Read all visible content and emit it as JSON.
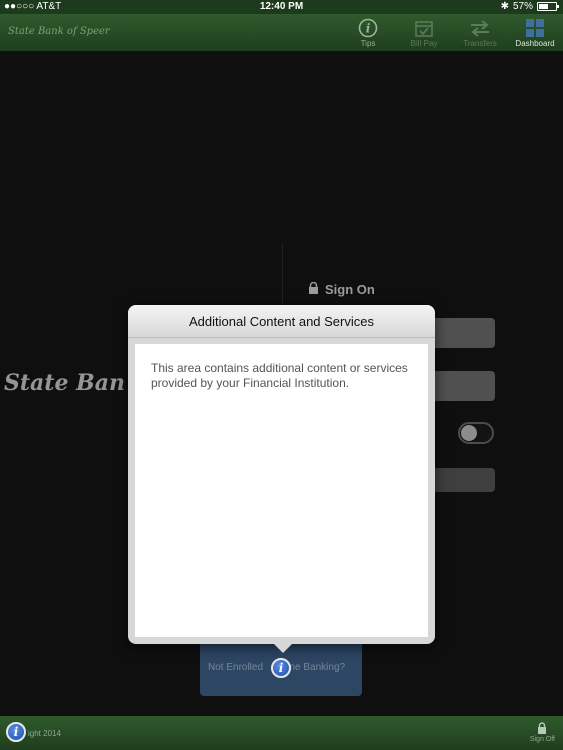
{
  "status_bar": {
    "carrier": "●●○○○ AT&T",
    "time": "12:40 PM",
    "battery": "57%"
  },
  "nav": {
    "brand": "State Bank of Speer",
    "items": [
      {
        "label": "Tips",
        "icon": "info-circle-icon"
      },
      {
        "label": "Bill Pay",
        "icon": "calendar-check-icon"
      },
      {
        "label": "Transfers",
        "icon": "transfer-arrows-icon"
      },
      {
        "label": "Dashboard",
        "icon": "dashboard-grid-icon"
      }
    ]
  },
  "background": {
    "bank_name_large": "State Ban",
    "sign_on_label": "Sign On",
    "enroll_left": "Not Enrolled",
    "enroll_right": "line Banking?"
  },
  "modal": {
    "title": "Additional Content and Services",
    "body": "This area contains additional content or services provided by your Financial Institution."
  },
  "footer": {
    "copyright": "ight 2014",
    "sign_off_label": "Sign Off"
  },
  "colors": {
    "nav_green": "#2f5a2d",
    "enroll_blue": "#3d5e86",
    "info_blue": "#1a4fb0"
  }
}
